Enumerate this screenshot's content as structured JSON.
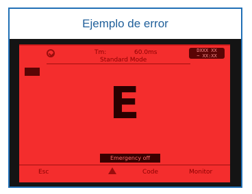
{
  "header": {
    "title": "Ejemplo de error"
  },
  "display": {
    "top_tm": "Tm:",
    "top_time": "60.0ms",
    "battery_top": "DXXX XX",
    "battery_bottom": "~ XX:XX",
    "mode": "Standard Mode",
    "main_symbol": "E",
    "emergency": "Emergency off",
    "softkeys": {
      "left": "Esc",
      "middle": "Code",
      "right": "Monitor"
    }
  },
  "colors": {
    "frame_border": "#1f6fb5",
    "title_text": "#1f5f9a",
    "device_body": "#141414",
    "screen_red": "#f42d2d",
    "dark_red": "#2a0000"
  },
  "icons": {
    "top_left": "circle-arrow-icon",
    "left_box": "indicator-box-icon",
    "bottom_middle": "warning-triangle-icon"
  }
}
